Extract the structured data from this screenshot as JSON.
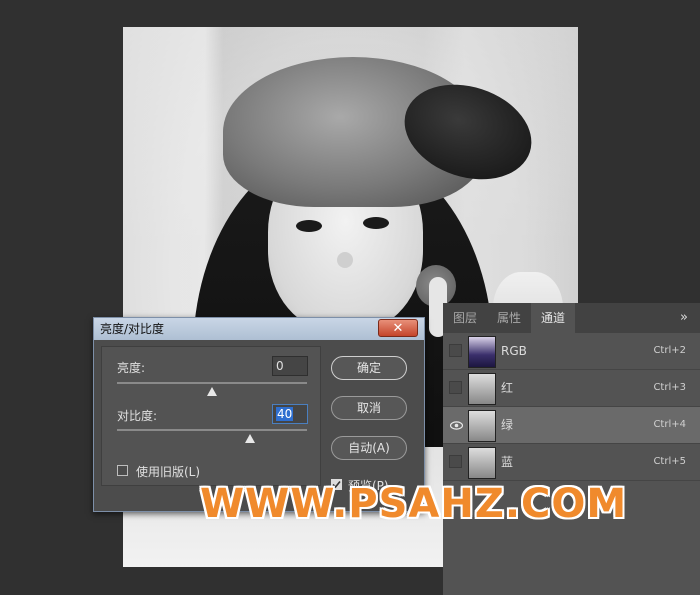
{
  "channels_panel": {
    "tabs": [
      {
        "label": "图层"
      },
      {
        "label": "属性"
      },
      {
        "label": "通道"
      }
    ],
    "menu_icon": "panel-menu-icon",
    "menu_glyph": "»",
    "rows": [
      {
        "name": "RGB",
        "shortcut": "Ctrl+2"
      },
      {
        "name": "红",
        "shortcut": "Ctrl+3"
      },
      {
        "name": "绿",
        "shortcut": "Ctrl+4"
      },
      {
        "name": "蓝",
        "shortcut": "Ctrl+5"
      }
    ]
  },
  "dialog": {
    "title": "亮度/对比度",
    "close_glyph": "✕",
    "brightness": {
      "label": "亮度:",
      "value": "0"
    },
    "contrast": {
      "label": "对比度:",
      "value": "40"
    },
    "legacy_label": "使用旧版(L)",
    "ok_label": "确定",
    "cancel_label": "取消",
    "auto_label": "自动(A)",
    "preview_label": "预览(P)"
  },
  "watermark": "WWW.PSAHZ.COM",
  "colors": {
    "background": "#303030",
    "panel": "#535353",
    "selected_row": "#6a6a6a",
    "watermark": "#f08a2c"
  }
}
